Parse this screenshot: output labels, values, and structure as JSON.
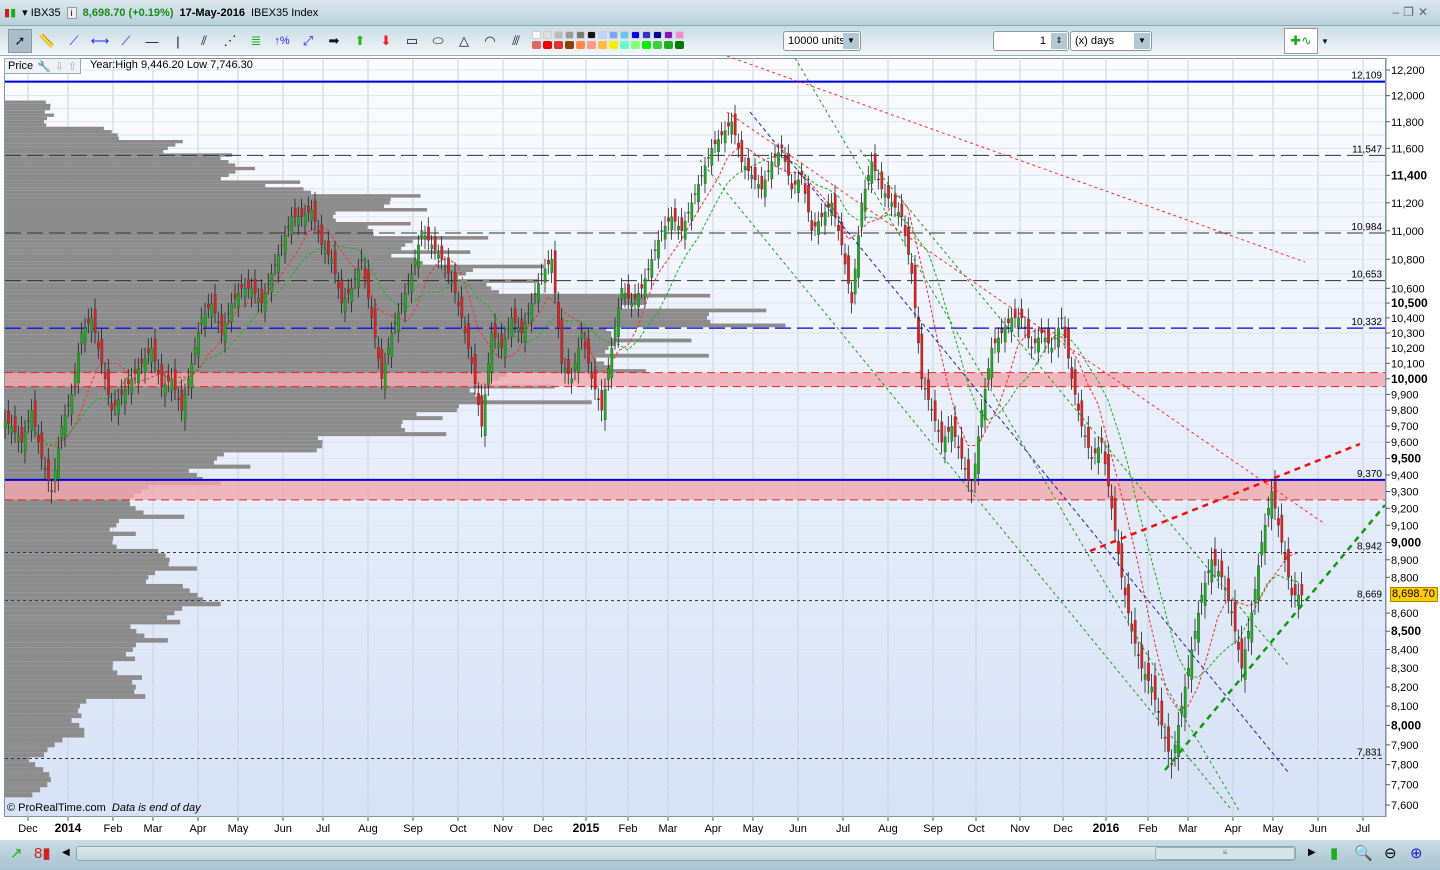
{
  "window": {
    "symbol": "IBX35",
    "price_change": "8,698.70 (+0.19%)",
    "date": "17-May-2016",
    "name": "IBEX35 Index"
  },
  "toolbar": {
    "units": "10000 units",
    "period_value": "1",
    "period_unit": "(x) days",
    "percent_tool": "%"
  },
  "chart_header": {
    "label": "Price",
    "year_info": "Year:High 9,446.20 Low 7,746.30"
  },
  "footer": {
    "copyright": "© ProRealTime.com",
    "note": "Data is end of day"
  },
  "last_price": "8,698.70",
  "chart_data": {
    "type": "candlestick",
    "scale": "log",
    "ylim": [
      7550,
      12300
    ],
    "y_ticks": [
      {
        "v": 12200,
        "l": "12,200"
      },
      {
        "v": 12000,
        "l": "12,000"
      },
      {
        "v": 11800,
        "l": "11,800"
      },
      {
        "v": 11600,
        "l": "11,600"
      },
      {
        "v": 11400,
        "l": "11,400",
        "b": true
      },
      {
        "v": 11200,
        "l": "11,200"
      },
      {
        "v": 11000,
        "l": "11,000"
      },
      {
        "v": 10800,
        "l": "10,800"
      },
      {
        "v": 10600,
        "l": "10,600"
      },
      {
        "v": 10500,
        "l": "10,500",
        "b": true
      },
      {
        "v": 10400,
        "l": "10,400"
      },
      {
        "v": 10300,
        "l": "10,300"
      },
      {
        "v": 10200,
        "l": "10,200"
      },
      {
        "v": 10100,
        "l": "10,100"
      },
      {
        "v": 10000,
        "l": "10,000",
        "b": true
      },
      {
        "v": 9900,
        "l": "9,900"
      },
      {
        "v": 9800,
        "l": "9,800"
      },
      {
        "v": 9700,
        "l": "9,700"
      },
      {
        "v": 9600,
        "l": "9,600"
      },
      {
        "v": 9500,
        "l": "9,500",
        "b": true
      },
      {
        "v": 9400,
        "l": "9,400"
      },
      {
        "v": 9300,
        "l": "9,300"
      },
      {
        "v": 9200,
        "l": "9,200"
      },
      {
        "v": 9100,
        "l": "9,100"
      },
      {
        "v": 9000,
        "l": "9,000",
        "b": true
      },
      {
        "v": 8900,
        "l": "8,900"
      },
      {
        "v": 8800,
        "l": "8,800"
      },
      {
        "v": 8600,
        "l": "8,600"
      },
      {
        "v": 8500,
        "l": "8,500",
        "b": true
      },
      {
        "v": 8400,
        "l": "8,400"
      },
      {
        "v": 8300,
        "l": "8,300"
      },
      {
        "v": 8200,
        "l": "8,200"
      },
      {
        "v": 8100,
        "l": "8,100"
      },
      {
        "v": 8000,
        "l": "8,000",
        "b": true
      },
      {
        "v": 7900,
        "l": "7,900"
      },
      {
        "v": 7800,
        "l": "7,800"
      },
      {
        "v": 7700,
        "l": "7,700"
      },
      {
        "v": 7600,
        "l": "7,600"
      }
    ],
    "x_ticks": [
      {
        "w": 2,
        "l": "Dec"
      },
      {
        "w": 6,
        "l": "2014",
        "b": true
      },
      {
        "w": 10.5,
        "l": "Feb"
      },
      {
        "w": 14.5,
        "l": "Mar"
      },
      {
        "w": 19,
        "l": "Apr"
      },
      {
        "w": 23,
        "l": "May"
      },
      {
        "w": 27.5,
        "l": "Jun"
      },
      {
        "w": 31.5,
        "l": "Jul"
      },
      {
        "w": 36,
        "l": "Aug"
      },
      {
        "w": 40.5,
        "l": "Sep"
      },
      {
        "w": 45,
        "l": "Oct"
      },
      {
        "w": 49.5,
        "l": "Nov"
      },
      {
        "w": 53.5,
        "l": "Dec"
      },
      {
        "w": 57.8,
        "l": "2015",
        "b": true
      },
      {
        "w": 62,
        "l": "Feb"
      },
      {
        "w": 66,
        "l": "Mar"
      },
      {
        "w": 70.5,
        "l": "Apr"
      },
      {
        "w": 74.5,
        "l": "May"
      },
      {
        "w": 79,
        "l": "Jun"
      },
      {
        "w": 83.5,
        "l": "Jul"
      },
      {
        "w": 88,
        "l": "Aug"
      },
      {
        "w": 92.5,
        "l": "Sep"
      },
      {
        "w": 96.8,
        "l": "Oct"
      },
      {
        "w": 101.2,
        "l": "Nov"
      },
      {
        "w": 105.5,
        "l": "Dec"
      },
      {
        "w": 109.8,
        "l": "2016",
        "b": true
      },
      {
        "w": 114,
        "l": "Feb"
      },
      {
        "w": 118,
        "l": "Mar"
      },
      {
        "w": 122.5,
        "l": "Apr"
      },
      {
        "w": 126.5,
        "l": "May"
      },
      {
        "w": 131,
        "l": "Jun"
      },
      {
        "w": 135.5,
        "l": "Jul"
      }
    ],
    "weekly_close": [
      9700,
      9600,
      9800,
      9500,
      9300,
      9700,
      9900,
      10300,
      10400,
      10100,
      9800,
      9900,
      10000,
      10100,
      10200,
      9950,
      10000,
      9800,
      10100,
      10400,
      10500,
      10300,
      10500,
      10600,
      10600,
      10500,
      10700,
      10900,
      11100,
      11100,
      11150,
      10900,
      10800,
      10500,
      10600,
      10800,
      10400,
      10000,
      10300,
      10500,
      10700,
      11000,
      10900,
      10800,
      10650,
      10400,
      10100,
      9700,
      10300,
      10200,
      10400,
      10300,
      10500,
      10700,
      10800,
      10100,
      10000,
      10300,
      10000,
      9800,
      10200,
      10600,
      10500,
      10600,
      10800,
      11000,
      11100,
      11000,
      11200,
      11400,
      11600,
      11700,
      11800,
      11500,
      11400,
      11300,
      11500,
      11600,
      11300,
      11400,
      11000,
      11100,
      11200,
      10900,
      10500,
      11200,
      11500,
      11300,
      11200,
      11100,
      10700,
      10000,
      9800,
      9600,
      9700,
      9500,
      9300,
      9800,
      10200,
      10300,
      10400,
      10400,
      10200,
      10300,
      10200,
      10400,
      10000,
      9700,
      9500,
      9600,
      9200,
      8800,
      8500,
      8300,
      8200,
      8000,
      7800,
      8100,
      8400,
      8700,
      8900,
      8800,
      8600,
      8300,
      8600,
      9000,
      9300,
      9000,
      8700,
      8700
    ],
    "levels": [
      {
        "v": 12109,
        "l": "12,109",
        "style": "blue-solid"
      },
      {
        "v": 11547,
        "l": "11,547",
        "style": "black-dash"
      },
      {
        "v": 10984,
        "l": "10,984",
        "style": "black-dash"
      },
      {
        "v": 10653,
        "l": "10,653",
        "style": "black-dash"
      },
      {
        "v": 10332,
        "l": "10,332",
        "style": "blue-dash"
      },
      {
        "v": 9370,
        "l": "9,370",
        "style": "blue-solid"
      },
      {
        "v": 8942,
        "l": "8,942",
        "style": "thin-dash"
      },
      {
        "v": 8669,
        "l": "8,669",
        "style": "thin-dash"
      },
      {
        "v": 7831,
        "l": "7,831",
        "style": "thin-dash"
      }
    ],
    "zones": [
      [
        9950,
        10040
      ],
      [
        9250,
        9370
      ]
    ],
    "colors": {
      "up": "#22aa22",
      "down": "#dd2222",
      "profile": "#8c8c8c"
    }
  }
}
